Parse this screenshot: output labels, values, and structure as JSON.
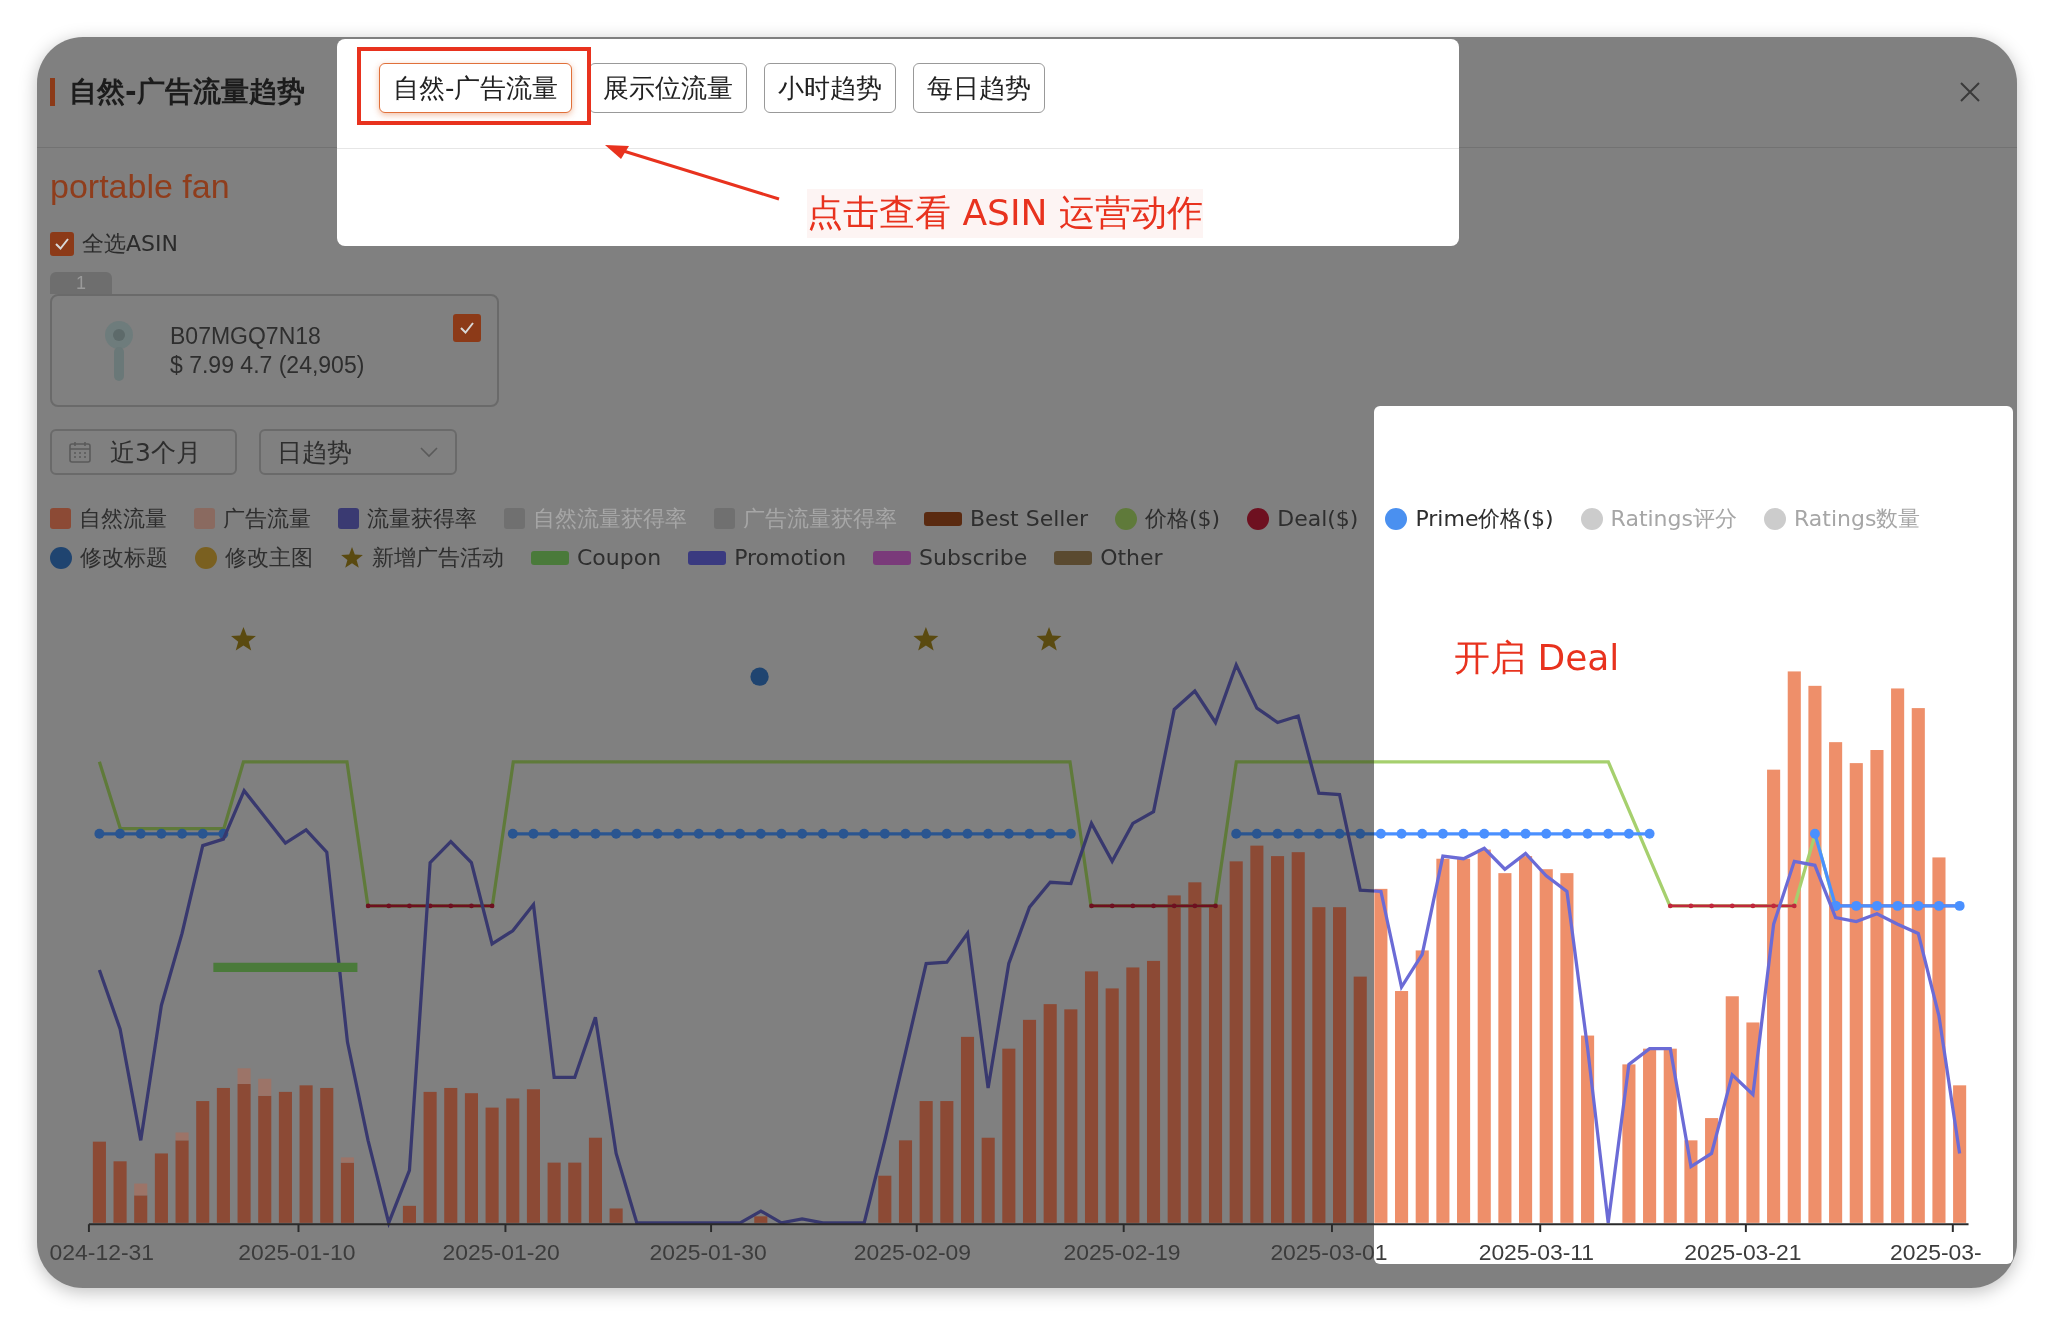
{
  "dialog": {
    "title": "自然-广告流量趋势"
  },
  "tabs": [
    {
      "label": "自然-广告流量",
      "selected": true
    },
    {
      "label": "展示位流量",
      "selected": false
    },
    {
      "label": "小时趋势",
      "selected": false
    },
    {
      "label": "每日趋势",
      "selected": false
    }
  ],
  "keyword": "portable fan",
  "select_all": {
    "label": "全选ASIN",
    "checked": true
  },
  "products": [
    {
      "index": "1",
      "asin": "B07MGQ7N18",
      "details": "$ 7.99 4.7 (24,905)",
      "checked": true
    }
  ],
  "date_range": {
    "value": "近3个月"
  },
  "granularity": {
    "value": "日趋势"
  },
  "legend_rows": [
    {
      "items": [
        {
          "label": "自然流量",
          "kind": "square",
          "color": "#8c4a35",
          "disabled": false
        },
        {
          "label": "广告流量",
          "kind": "square",
          "color": "#8a6a60",
          "disabled": false
        },
        {
          "label": "流量获得率",
          "kind": "square",
          "color": "#3a3a72",
          "disabled": false
        },
        {
          "label": "自然流量获得率",
          "kind": "square",
          "color": "#707070",
          "disabled": true
        },
        {
          "label": "广告流量获得率",
          "kind": "square",
          "color": "#707070",
          "disabled": true
        },
        {
          "label": "Best Seller",
          "kind": "line",
          "color": "#5a2a10",
          "disabled": false
        },
        {
          "label": "价格($)",
          "kind": "dot",
          "color": "#5f7a3a",
          "disabled": false
        },
        {
          "label": "Deal($)",
          "kind": "dot",
          "color": "#6e1020",
          "disabled": false
        },
        {
          "label": "Prime价格($)",
          "kind": "dot",
          "color": "#4a90f0",
          "disabled": false
        },
        {
          "label": "Ratings评分",
          "kind": "dot",
          "color": "#cccccc",
          "disabled": true
        },
        {
          "label": "Ratings数量",
          "kind": "dot",
          "color": "#cccccc",
          "disabled": true
        }
      ]
    },
    {
      "items": [
        {
          "label": "修改标题",
          "kind": "dot",
          "color": "#1f4470",
          "disabled": false
        },
        {
          "label": "修改主图",
          "kind": "dot",
          "color": "#7a6020",
          "disabled": false
        },
        {
          "label": "新增广告活动",
          "kind": "star",
          "color": "#5a4a10",
          "disabled": false
        },
        {
          "label": "Coupon",
          "kind": "line",
          "color": "#4a7a3a",
          "disabled": false
        },
        {
          "label": "Promotion",
          "kind": "line",
          "color": "#3a3a80",
          "disabled": false
        },
        {
          "label": "Subscribe",
          "kind": "line",
          "color": "#7a3a7a",
          "disabled": false
        },
        {
          "label": "Other",
          "kind": "line",
          "color": "#5a4a30",
          "disabled": false
        }
      ]
    }
  ],
  "chart": {
    "x_labels": [
      "024-12-31",
      "2025-01-10",
      "2025-01-20",
      "2025-01-30",
      "2025-02-09",
      "2025-02-19",
      "2025-03-01",
      "2025-03-11",
      "2025-03-21",
      "2025-03-"
    ]
  },
  "annotations": [
    {
      "kind": "tab_callout",
      "text": "点击查看 ASIN 运营动作"
    },
    {
      "kind": "deal_note",
      "text": "开启 Deal"
    }
  ]
}
